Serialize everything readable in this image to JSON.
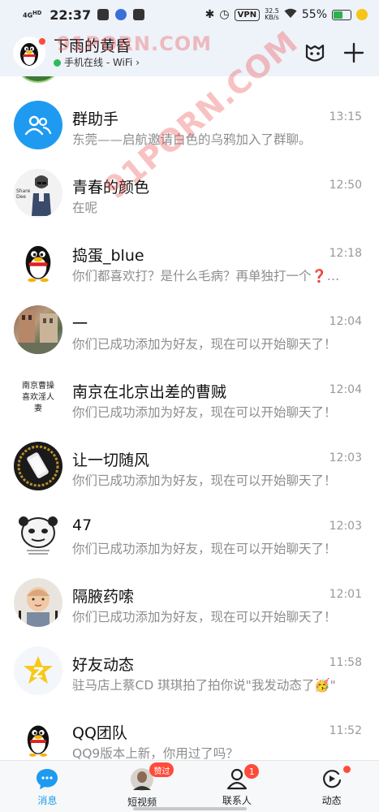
{
  "status_bar": {
    "network": "4G",
    "network_sub": "HD",
    "time": "22:37",
    "vpn": "VPN",
    "speed": "32.5",
    "speed_unit": "KB/s",
    "battery": "55%",
    "battery_level": 0.55
  },
  "header": {
    "name": "下雨的黄昏",
    "status": "手机在线 - WiFi",
    "status_chevron": "›"
  },
  "watermarks": [
    "91PORN.COM",
    "91PORN.COM"
  ],
  "conversations": [
    {
      "title": "群助手",
      "time": "13:15",
      "message": "东莞——启航邀请白色的乌鸦加入了群聊。",
      "avatar": "group-helper-icon",
      "avatar_color": "#1e9bf0"
    },
    {
      "title": "青春的颜色",
      "time": "12:50",
      "message": "在呢",
      "avatar": "sketch-avatar",
      "avatar_text": "Share Dee"
    },
    {
      "title": "捣蛋_blue",
      "time": "12:18",
      "message": "你们都喜欢打？是什么毛病？再单独打一个❓…",
      "avatar": "penguin-avatar"
    },
    {
      "title": "一",
      "time": "12:04",
      "message": "你们已成功添加为好友，现在可以开始聊天了！",
      "avatar": "street-photo-avatar"
    },
    {
      "title": "南京在北京出差的曹贼",
      "time": "12:04",
      "message": "你们已成功添加为好友，现在可以开始聊天了！",
      "avatar": "text-avatar",
      "avatar_text": "南京曹操 喜欢淫人妻"
    },
    {
      "title": "让一切随风",
      "time": "12:03",
      "message": "你们已成功添加为好友，现在可以开始聊天了！",
      "avatar": "phone-photo-avatar"
    },
    {
      "title": "47",
      "time": "12:03",
      "message": "你们已成功添加为好友，现在可以开始聊天了！",
      "avatar": "meme-avatar"
    },
    {
      "title": "隔腋药嗦",
      "time": "12:01",
      "message": "你们已成功添加为好友，现在可以开始聊天了！",
      "avatar": "baby-photo-avatar"
    },
    {
      "title": "好友动态",
      "time": "11:58",
      "message": "驻马店上蔡CD 琪琪拍了拍你说\"我发动态了🥳\"",
      "avatar": "star-icon",
      "avatar_color": "#f7c81e"
    },
    {
      "title": "QQ团队",
      "time": "11:52",
      "message": "QQ9版本上新，你用过了吗？",
      "avatar": "penguin-avatar"
    }
  ],
  "bottom_nav": [
    {
      "label": "消息",
      "icon": "message-icon",
      "active": true
    },
    {
      "label": "短视频",
      "icon": "video-avatar-icon",
      "badge": "赞过"
    },
    {
      "label": "联系人",
      "icon": "contacts-icon",
      "badge": "1"
    },
    {
      "label": "动态",
      "icon": "moments-icon",
      "dot": true
    }
  ],
  "colors": {
    "accent": "#1e9bf0",
    "badge": "#ff4b3a",
    "online": "#2bbd5a",
    "header_bg": "#eef2f9"
  }
}
